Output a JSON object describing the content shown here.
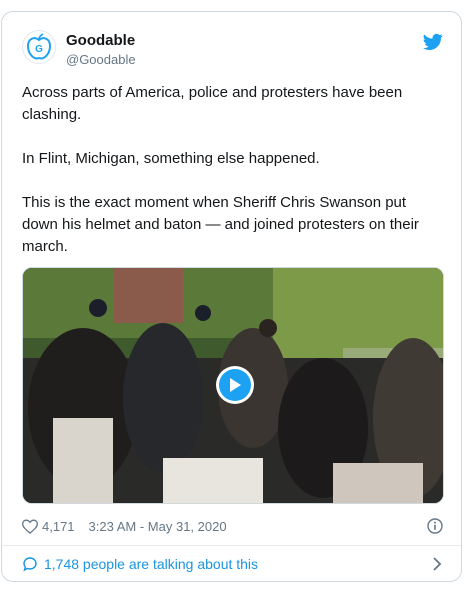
{
  "account": {
    "name": "Goodable",
    "handle": "@Goodable",
    "avatar_icon": "goodable-apple-logo-icon",
    "platform_icon": "twitter-bird-icon"
  },
  "tweet": {
    "text": "Across parts of America, police and protesters have been clashing.\n\nIn Flint, Michigan, something else happened.\n\nThis is the exact moment when Sheriff Chris Swanson put down his helmet and baton — and joined protesters on their march."
  },
  "media": {
    "type": "video",
    "play_icon": "play-icon"
  },
  "meta": {
    "likes": "4,171",
    "timestamp": "3:23 AM - May 31, 2020",
    "like_icon": "heart-icon",
    "info_icon": "info-icon"
  },
  "footer": {
    "talking": "1,748 people are talking about this",
    "bubble_icon": "comment-bubble-icon",
    "chevron_icon": "chevron-right-icon"
  },
  "colors": {
    "accent": "#1da1f2",
    "link": "#1b95e0",
    "muted": "#657786",
    "border": "#cfd9de"
  }
}
